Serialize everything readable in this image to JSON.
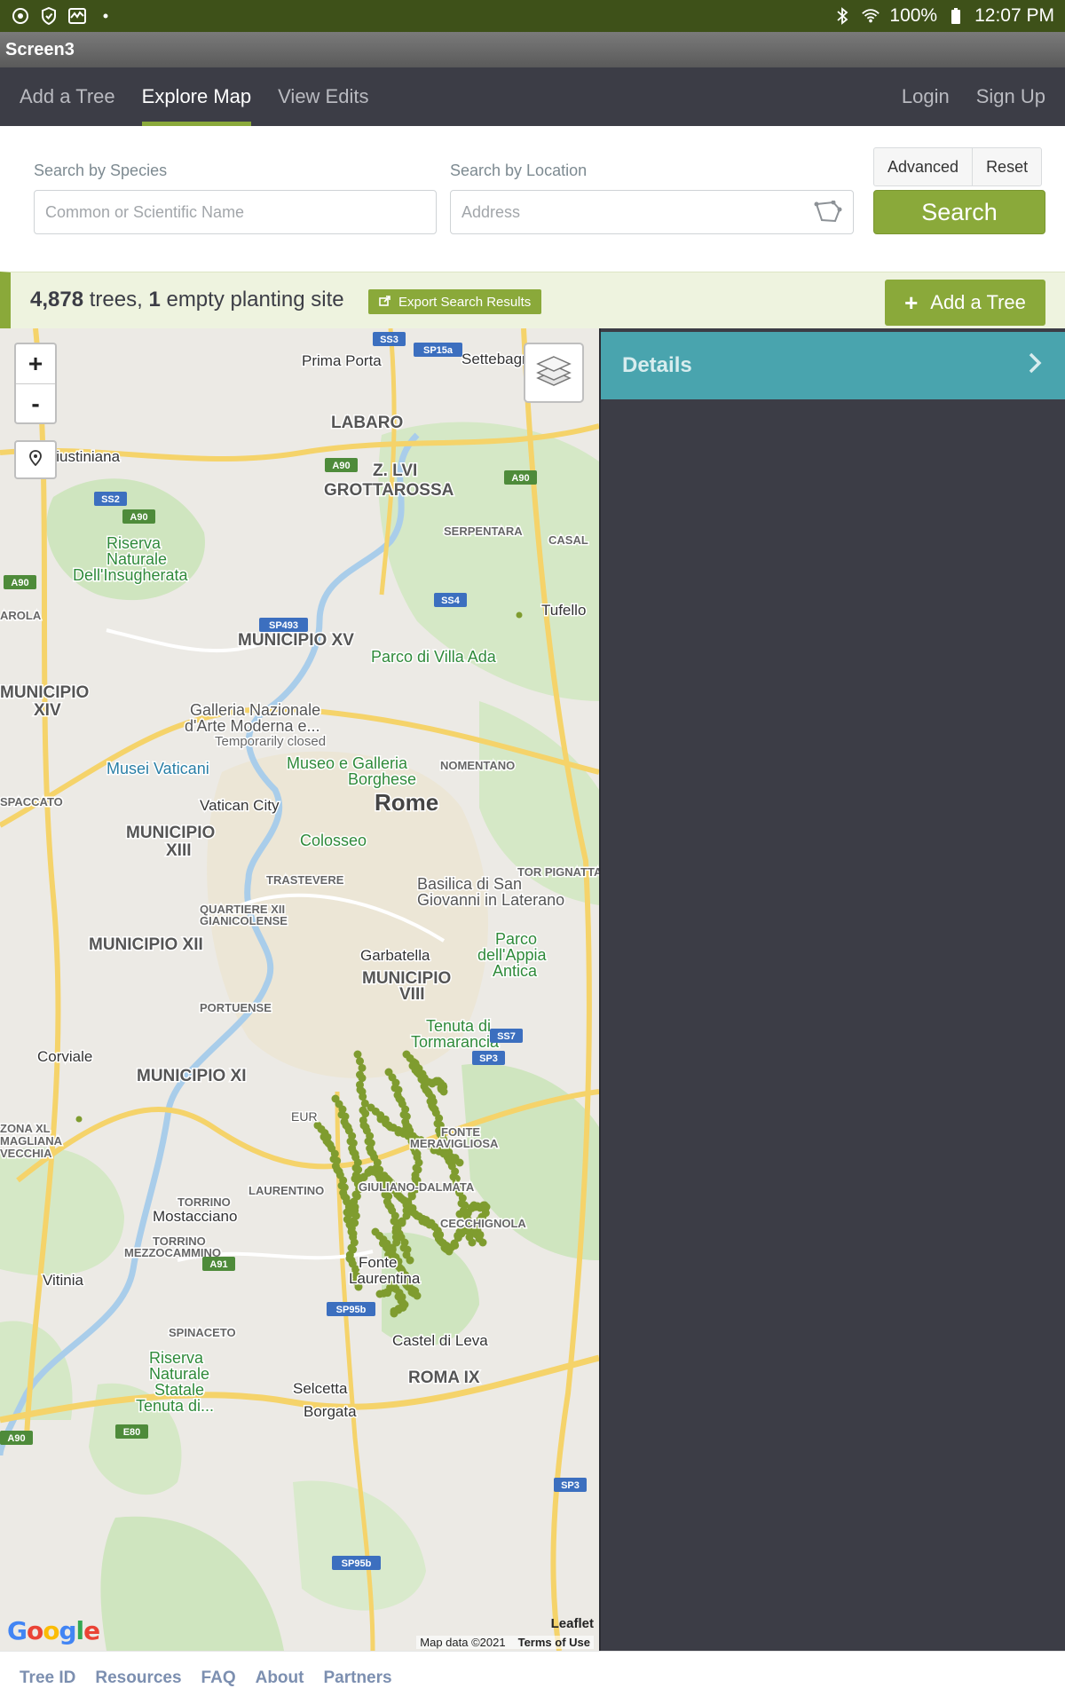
{
  "status_bar": {
    "battery": "100%",
    "time": "12:07 PM"
  },
  "app": {
    "title": "Screen3"
  },
  "nav": {
    "left": [
      {
        "label": "Add a Tree",
        "active": false
      },
      {
        "label": "Explore Map",
        "active": true
      },
      {
        "label": "View Edits",
        "active": false
      }
    ],
    "right": [
      {
        "label": "Login"
      },
      {
        "label": "Sign Up"
      }
    ]
  },
  "search": {
    "species_label": "Search by Species",
    "species_placeholder": "Common or Scientific Name",
    "location_label": "Search by Location",
    "location_placeholder": "Address",
    "advanced_label": "Advanced",
    "reset_label": "Reset",
    "search_label": "Search"
  },
  "results": {
    "tree_count": "4,878",
    "trees_word": "trees,",
    "site_count": "1",
    "site_word": "empty planting site",
    "export_label": "Export Search Results",
    "add_tree_label": "Add a Tree"
  },
  "map": {
    "labels": [
      "Prima Porta",
      "Settebagni",
      "LABARO",
      "Giustiniana",
      "Z. LVI",
      "GROTTAROSSA",
      "SERPENTARA",
      "CASAL",
      "Riserva",
      "Naturale",
      "Dell'Insugherata",
      "Tufello",
      "MUNICIPIO XV",
      "Parco di Villa Ada",
      "MUNICIPIO",
      "XIV",
      "Galleria Nazionale",
      "d'Arte Moderna e...",
      "Temporarily closed",
      "Musei Vaticani",
      "Museo e Galleria",
      "Borghese",
      "NOMENTANO",
      "Vatican City",
      "Rome",
      "MUNICIPIO",
      "XIII",
      "Colosseo",
      "TRASTEVERE",
      "Basilica di San",
      "Giovanni in Laterano",
      "QUARTIERE XII",
      "GIANICOLENSE",
      "MUNICIPIO XII",
      "Parco",
      "dell'Appia",
      "Antica",
      "Garbatella",
      "MUNICIPIO",
      "VIII",
      "PORTUENSE",
      "Tenuta di",
      "Tormarancia",
      "Corviale",
      "MUNICIPIO XI",
      "EUR",
      "FONTE",
      "MERAVIGLIOSA",
      "LAURENTINO",
      "GIULIANO-DALMATA",
      "TORRINO",
      "Mostacciano",
      "CECCHIGNOLA",
      "TORRINO",
      "MEZZOCAMMINO",
      "Vitinia",
      "Fonte",
      "Laurentina",
      "Castel di Leva",
      "SPINACETO",
      "Riserva",
      "Naturale",
      "Statale",
      "Tenuta di...",
      "ROMA IX",
      "Selcetta",
      "Borgata",
      "SPACCATO",
      "ZONA XL",
      "MAGLIANA",
      "VECCHIA",
      "AROLA",
      "TOR PIGNATTARA"
    ],
    "road_shields": [
      "SS3",
      "SP15a",
      "A90",
      "A90",
      "SS2",
      "A90",
      "SS4",
      "SP493",
      "A90",
      "SS7",
      "A91",
      "SP95b",
      "E80",
      "A90",
      "SP3",
      "SP95b",
      "SP3"
    ],
    "leaflet": "Leaflet",
    "map_data": "Map data ©2021",
    "terms": "Terms of Use",
    "google": "Google"
  },
  "details": {
    "title": "Details"
  },
  "footer": {
    "links": [
      "Tree ID",
      "Resources",
      "FAQ",
      "About",
      "Partners"
    ]
  },
  "colors": {
    "accent": "#8aa93a",
    "nav_bg": "#3c3d46",
    "status_bg": "#3e5119",
    "details_header": "#49a4ae",
    "tree_dot": "#7f9c2f"
  }
}
